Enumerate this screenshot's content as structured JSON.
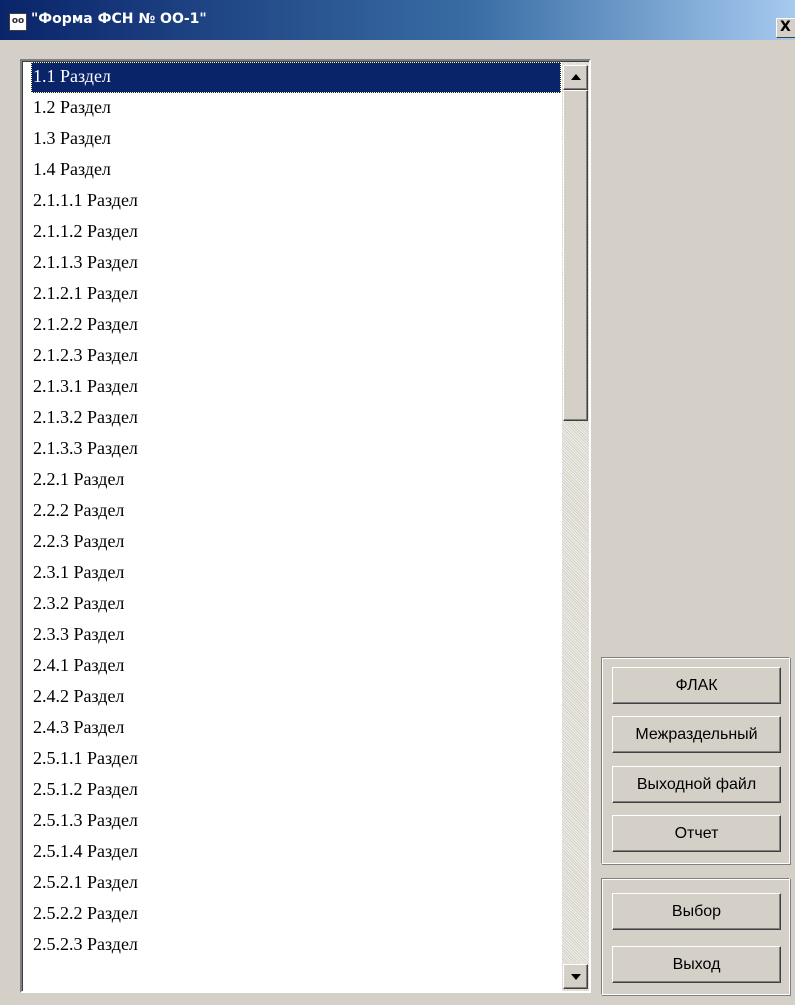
{
  "window": {
    "title": "\"Форма ФСН № ОО-1\"",
    "icon": "app-icon",
    "close_label": "X"
  },
  "list": {
    "selected_index": 0,
    "items": [
      "1.1 Раздел",
      "1.2 Раздел",
      "1.3 Раздел",
      "1.4 Раздел",
      "2.1.1.1 Раздел",
      "2.1.1.2 Раздел",
      "2.1.1.3 Раздел",
      "2.1.2.1 Раздел",
      "2.1.2.2 Раздел",
      "2.1.2.3 Раздел",
      "2.1.3.1 Раздел",
      "2.1.3.2 Раздел",
      "2.1.3.3 Раздел",
      "2.2.1 Раздел",
      "2.2.2 Раздел",
      "2.2.3 Раздел",
      "2.3.1 Раздел",
      "2.3.2 Раздел",
      "2.3.3 Раздел",
      "2.4.1 Раздел",
      "2.4.2 Раздел",
      "2.4.3 Раздел",
      "2.5.1.1 Раздел",
      "2.5.1.2 Раздел",
      "2.5.1.3 Раздел",
      "2.5.1.4 Раздел",
      "2.5.2.1 Раздел",
      "2.5.2.2 Раздел",
      "2.5.2.3 Раздел"
    ]
  },
  "buttons": {
    "flak": "ФЛАК",
    "mezhrazdelny": "Межраздельный",
    "vyhodnoy_fayl": "Выходной файл",
    "otchet": "Отчет",
    "vybor": "Выбор",
    "vyhod": "Выход"
  },
  "colors": {
    "title_bar_start": "#0a246a",
    "title_bar_end": "#a6caf0",
    "selection": "#0a246a",
    "window_bg": "#d4d0c8"
  }
}
